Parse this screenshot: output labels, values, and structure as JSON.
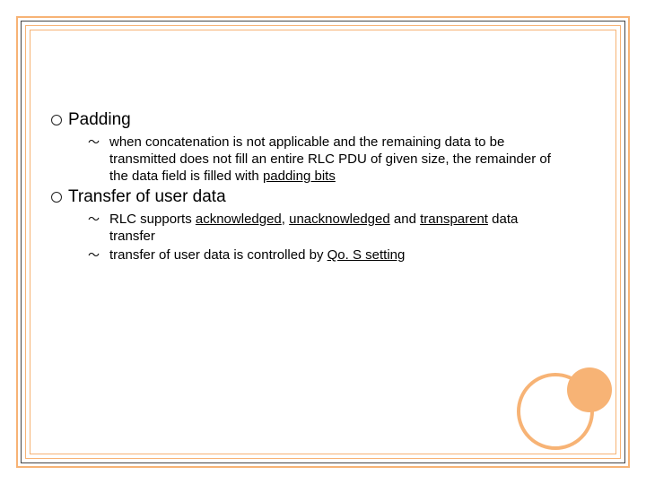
{
  "accent_color": "#f7b375",
  "sections": [
    {
      "title": "Padding",
      "items": [
        {
          "p0": "when concatenation is not applicable and the remaining data to be transmitted does not fill an entire RLC PDU of given size, the remainder of the data field is filled with ",
          "u0": "padding bits"
        }
      ]
    },
    {
      "title": "Transfer of user data",
      "items": [
        {
          "p0": "RLC supports ",
          "u0": "acknowledged",
          "p1": ", ",
          "u1": "unacknowledged",
          "p2": " and ",
          "u2": "transparent",
          "p3": " data transfer"
        },
        {
          "p0": "transfer of user data is controlled by ",
          "u0": "Qo. S setting"
        }
      ]
    }
  ]
}
